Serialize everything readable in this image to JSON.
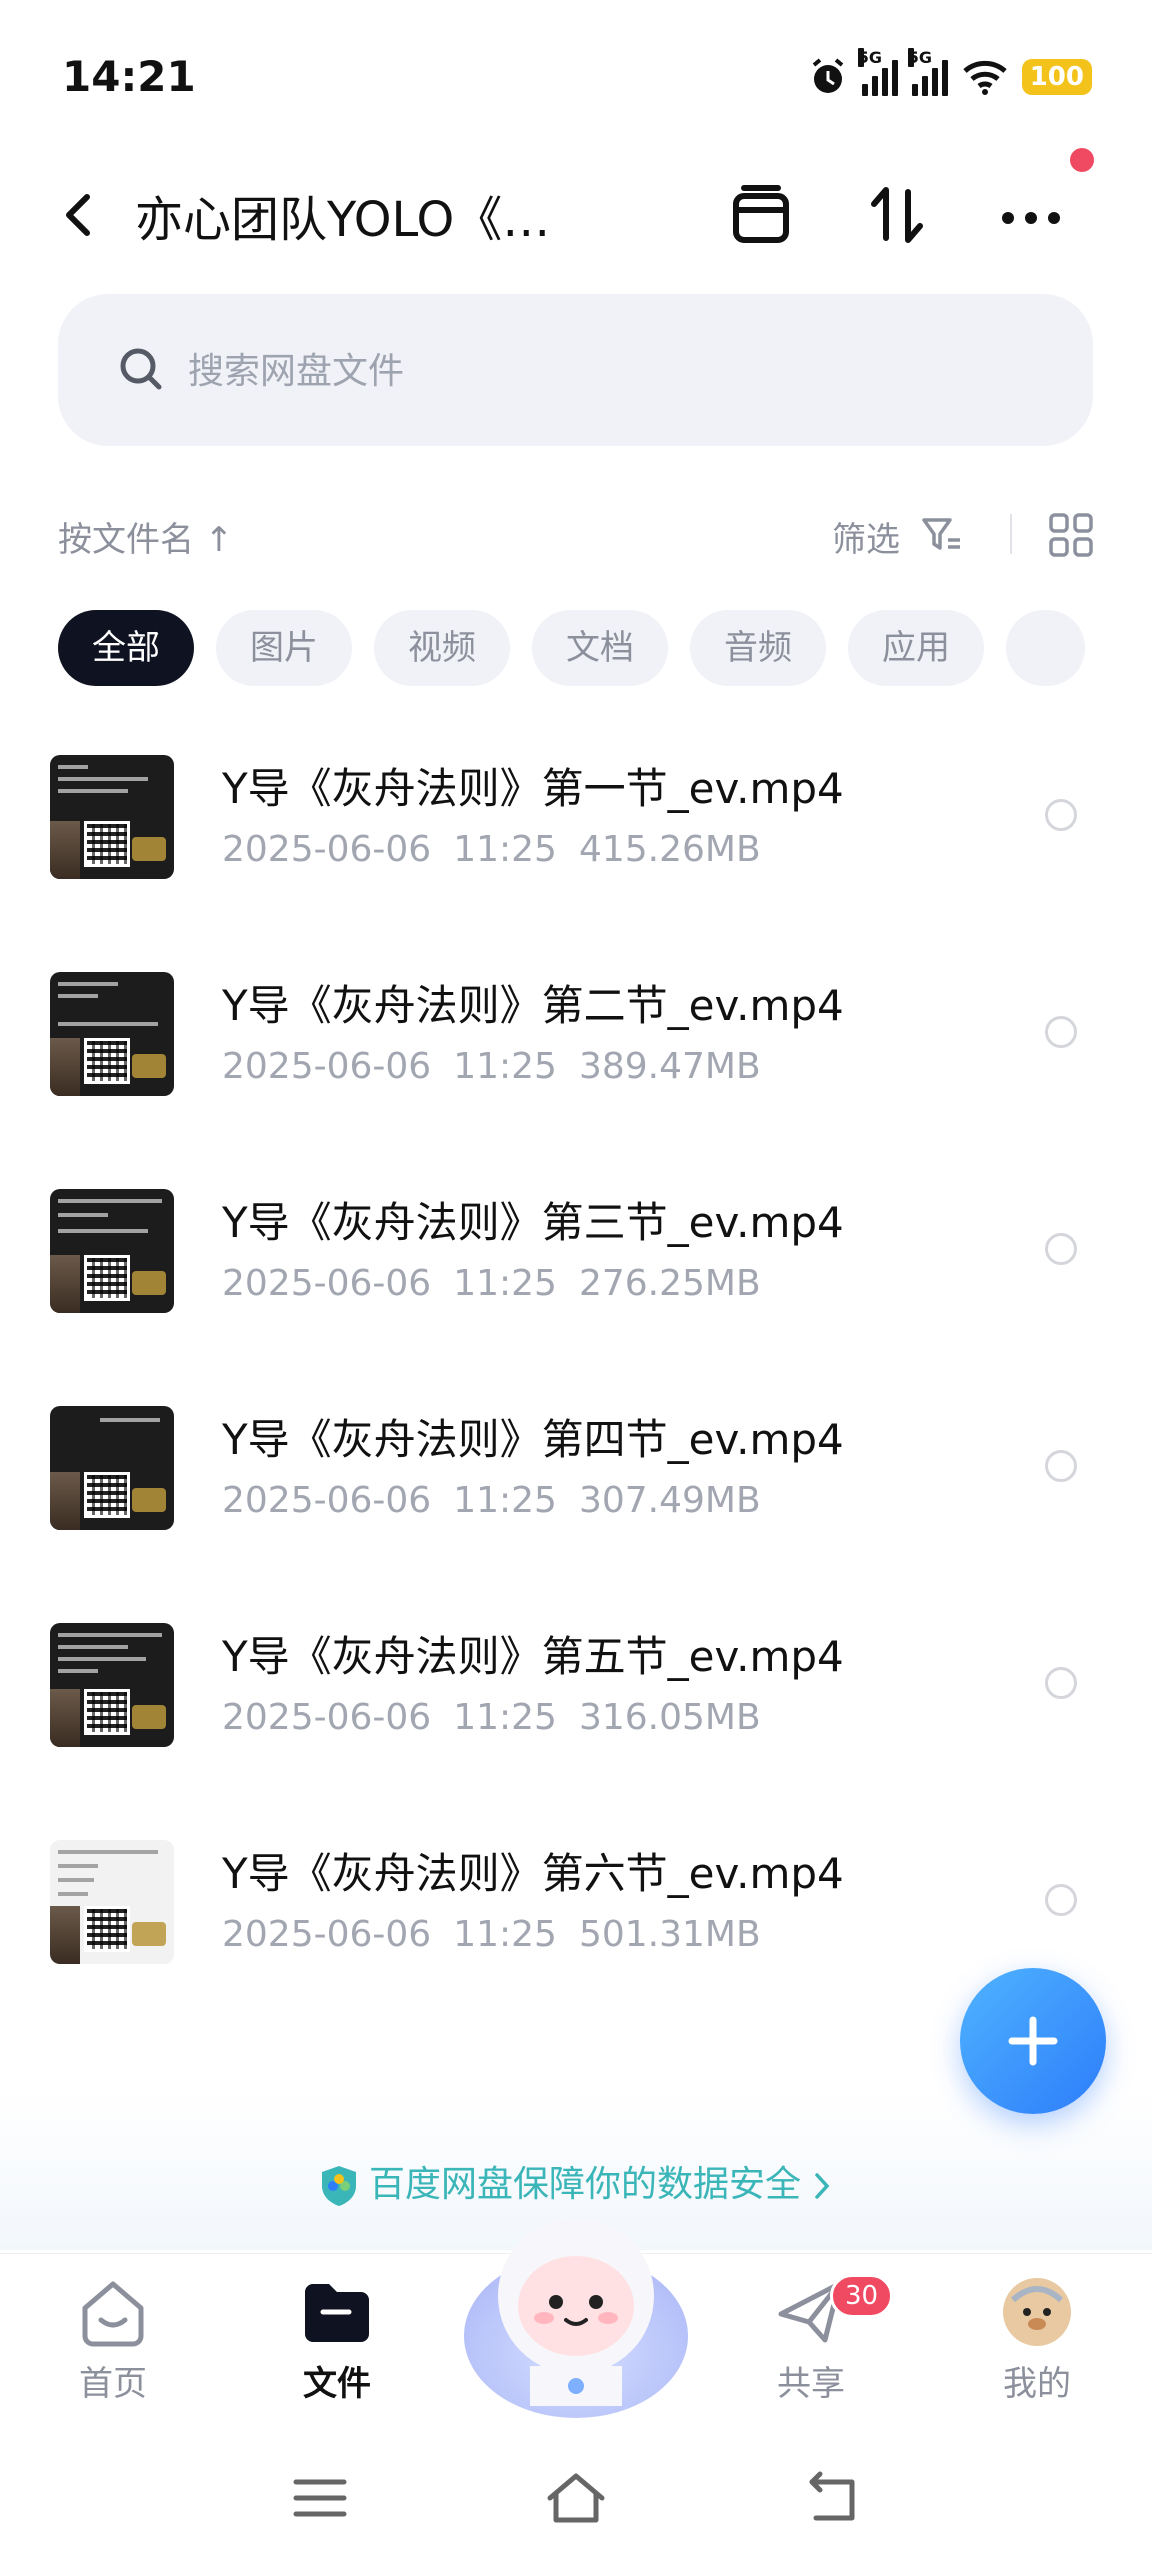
{
  "status_bar": {
    "time": "14:21",
    "network_1": "5G",
    "network_2": "5G",
    "battery": "100"
  },
  "header": {
    "title": "亦心团队YOLO《…",
    "icons": [
      "back-icon",
      "archive-icon",
      "sort-icon",
      "more-icon"
    ]
  },
  "search": {
    "placeholder": "搜索网盘文件"
  },
  "sort": {
    "label": "按文件名 ↑",
    "filter_label": "筛选"
  },
  "categories": [
    {
      "label": "全部",
      "active": true
    },
    {
      "label": "图片",
      "active": false
    },
    {
      "label": "视频",
      "active": false
    },
    {
      "label": "文档",
      "active": false
    },
    {
      "label": "音频",
      "active": false
    },
    {
      "label": "应用",
      "active": false
    }
  ],
  "files": [
    {
      "name": "Y导《灰舟法则》第一节_ev.mp4",
      "date": "2025-06-06",
      "time": "11:25",
      "size": "415.26MB"
    },
    {
      "name": "Y导《灰舟法则》第二节_ev.mp4",
      "date": "2025-06-06",
      "time": "11:25",
      "size": "389.47MB"
    },
    {
      "name": "Y导《灰舟法则》第三节_ev.mp4",
      "date": "2025-06-06",
      "time": "11:25",
      "size": "276.25MB"
    },
    {
      "name": "Y导《灰舟法则》第四节_ev.mp4",
      "date": "2025-06-06",
      "time": "11:25",
      "size": "307.49MB"
    },
    {
      "name": "Y导《灰舟法则》第五节_ev.mp4",
      "date": "2025-06-06",
      "time": "11:25",
      "size": "316.05MB"
    },
    {
      "name": "Y导《灰舟法则》第六节_ev.mp4",
      "date": "2025-06-06",
      "time": "11:25",
      "size": "501.31MB"
    }
  ],
  "security_notice": "百度网盘保障你的数据安全",
  "bottom_nav": {
    "home": "首页",
    "files": "文件",
    "share": "共享",
    "share_badge": "30",
    "mine": "我的"
  },
  "colors": {
    "accent": "#2d7dfa",
    "active_chip": "#0f1220",
    "badge": "#f04a62",
    "secure_text": "#3ab5b8",
    "battery": "#f3c21b"
  }
}
